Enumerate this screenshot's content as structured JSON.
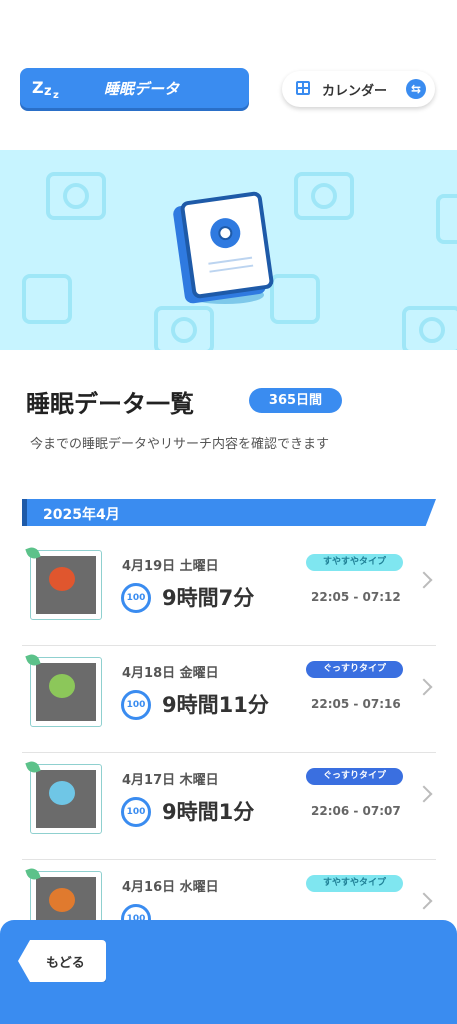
{
  "header": {
    "title": "睡眠データ",
    "calendar_label": "カレンダー"
  },
  "list": {
    "title": "睡眠データ一覧",
    "days_badge": "365日間",
    "subtitle": "今までの睡眠データやリサーチ内容を確認できます",
    "month": "2025年4月"
  },
  "entries": [
    {
      "date": "4月19日 土曜日",
      "type": "すやすやタイプ",
      "score": "100",
      "duration": "9時間7分",
      "time_range": "22:05 - 07:12"
    },
    {
      "date": "4月18日 金曜日",
      "type": "ぐっすりタイプ",
      "score": "100",
      "duration": "9時間11分",
      "time_range": "22:05 - 07:16"
    },
    {
      "date": "4月17日 木曜日",
      "type": "ぐっすりタイプ",
      "score": "100",
      "duration": "9時間1分",
      "time_range": "22:06 - 07:07"
    },
    {
      "date": "4月16日 水曜日",
      "type": "すやすやタイプ",
      "score": "100",
      "duration": "",
      "time_range": ""
    }
  ],
  "footer": {
    "back_label": "もどる"
  },
  "colors": {
    "accent": "#3a8cf0",
    "banner_bg": "#c7f4ff",
    "type_light": "#7fe6f0",
    "type_deep": "#3a6fe0"
  }
}
